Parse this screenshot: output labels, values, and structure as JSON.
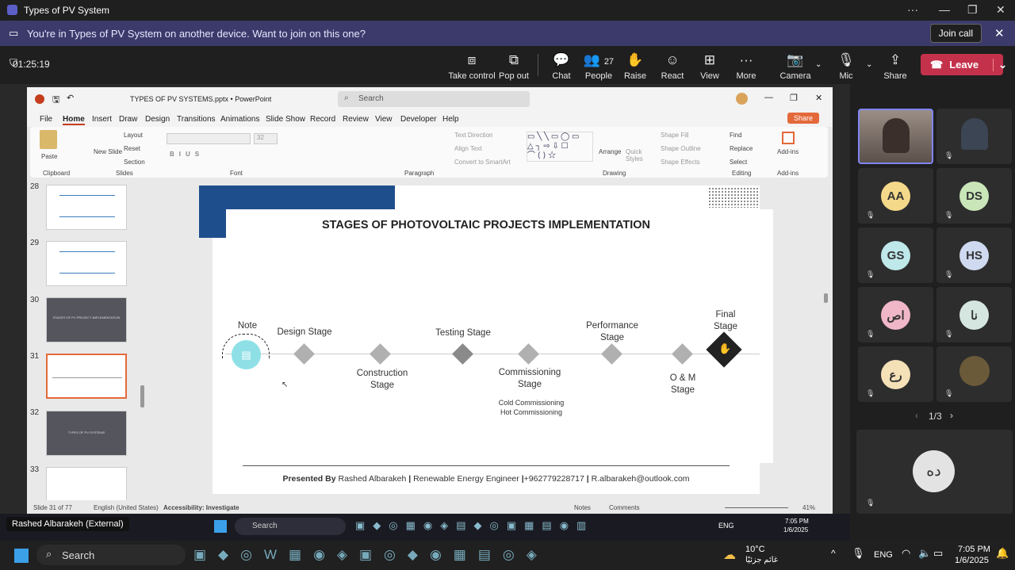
{
  "window": {
    "title": "Types of PV System"
  },
  "banner": {
    "message": "You're in Types of PV System on another device. Want to join on this one?",
    "join_label": "Join call"
  },
  "meeting": {
    "timer": "01:25:19",
    "people_count": "27",
    "leave_label": "Leave",
    "toolbar": [
      {
        "label": "Take control",
        "icon": "screen-icon"
      },
      {
        "label": "Pop out",
        "icon": "popout-icon"
      },
      {
        "label": "Chat",
        "icon": "chat-icon"
      },
      {
        "label": "People",
        "icon": "people-icon"
      },
      {
        "label": "Raise",
        "icon": "hand-icon"
      },
      {
        "label": "React",
        "icon": "smile-icon"
      },
      {
        "label": "View",
        "icon": "grid-icon"
      },
      {
        "label": "More",
        "icon": "more-icon"
      },
      {
        "label": "Camera",
        "icon": "camera-off-icon"
      },
      {
        "label": "Mic",
        "icon": "mic-off-icon"
      },
      {
        "label": "Share",
        "icon": "share-icon"
      }
    ]
  },
  "ppt": {
    "doc_title": "TYPES OF PV SYSTEMS.pptx  •  PowerPoint",
    "search_placeholder": "Search",
    "share_label": "Share",
    "tabs": [
      "File",
      "Home",
      "Insert",
      "Draw",
      "Design",
      "Transitions",
      "Animations",
      "Slide Show",
      "Record",
      "Review",
      "View",
      "Developer",
      "Help"
    ],
    "ribbon_groups": [
      "Clipboard",
      "Slides",
      "Font",
      "Paragraph",
      "Drawing",
      "Editing",
      "Add-ins"
    ],
    "ribbon_items": {
      "paste": "Paste",
      "new_slide": "New Slide",
      "layout": "Layout",
      "reset": "Reset",
      "section": "Section",
      "text_direction": "Text Direction",
      "align_text": "Align Text",
      "convert_smartart": "Convert to SmartArt",
      "arrange": "Arrange",
      "quick_styles": "Quick Styles",
      "shape_fill": "Shape Fill",
      "shape_outline": "Shape Outline",
      "shape_effects": "Shape Effects",
      "find": "Find",
      "replace": "Replace",
      "select": "Select",
      "addins": "Add-ins",
      "font_size": "32"
    },
    "thumbnails": [
      {
        "num": "28",
        "title": ""
      },
      {
        "num": "29",
        "title": ""
      },
      {
        "num": "30",
        "title": "STAGES OF PV PROJECT IMPLEMENTATION"
      },
      {
        "num": "31",
        "title": ""
      },
      {
        "num": "32",
        "title": "TYPES OF PV SYSTEMS"
      },
      {
        "num": "33",
        "title": ""
      }
    ],
    "status": {
      "slide": "Slide 31 of 77",
      "lang": "English (United States)",
      "access": "Accessibility: Investigate",
      "notes": "Notes",
      "comments": "Comments",
      "zoom": "41%"
    }
  },
  "slide": {
    "title": "STAGES OF PHOTOVOLTAIC PROJECTS IMPLEMENTATION",
    "note": "Note",
    "stages_top": [
      "Design Stage",
      "Testing Stage",
      "Performance Stage",
      "Final Stage"
    ],
    "stages_bottom": [
      "Construction Stage",
      "Commissioning Stage",
      "O & M Stage"
    ],
    "commissioning_sub": [
      "Cold Commissioning",
      "Hot Commissioning"
    ],
    "footer_bold": "Presented By",
    "footer_name": "Rashed Albarakeh",
    "footer_role": "Renewable Energy Engineer",
    "footer_phone": "+962779228717",
    "footer_email": "R.albarakeh@outlook.com"
  },
  "participants": {
    "page": "1/3",
    "initials": [
      "AA",
      "DS",
      "GS",
      "HS",
      "اص",
      "نا",
      "رع"
    ],
    "big": "ده"
  },
  "presenter_label": "Rashed Albarakeh (External)",
  "taskbar": {
    "search": "Search",
    "weather_temp": "10°C",
    "weather_desc": "غائم جزئيًا",
    "lang": "ENG",
    "time": "7:05 PM",
    "date": "1/6/2025"
  }
}
